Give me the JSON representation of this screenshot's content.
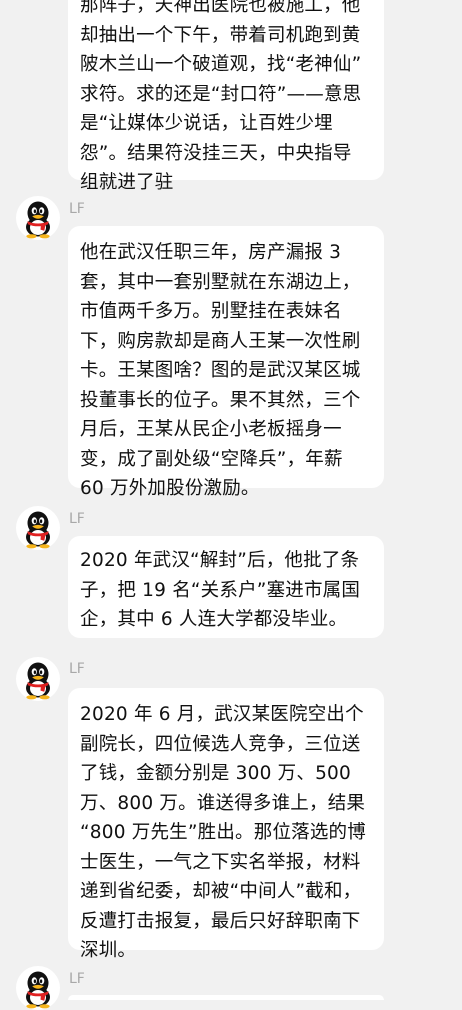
{
  "messages": [
    {
      "lines": [
        "那阵子，天神出医院也被施工，他",
        "却抽出一个下午，带着司机跑到黄",
        "陂木兰山一个破道观，找“老神仙”",
        "求符。求的还是“封口符”——意思",
        "是“让媒体少说话，让百姓少埋",
        "怨”。结果符没挂三天，中央指导",
        "组就进了驻"
      ]
    },
    {
      "sender": "LF",
      "avatar_icon": "qq-penguin-icon",
      "lines": [
        "他在武汉任职三年，房产漏报 3",
        "套，其中一套别墅就在东湖边上，",
        "市值两千多万。别墅挂在表妹名",
        "下，购房款却是商人王某一次性刷",
        "卡。王某图啥？图的是武汉某区城",
        "投董事长的位子。果不其然，三个",
        "月后，王某从民企小老板摇身一",
        "变，成了副处级“空降兵”，年薪",
        "60 万外加股份激励。"
      ]
    },
    {
      "sender": "LF",
      "avatar_icon": "qq-penguin-icon",
      "lines": [
        "2020 年武汉“解封”后，他批了条",
        "子，把 19 名“关系户”塞进市属国",
        "企，其中 6 人连大学都没毕业。"
      ]
    },
    {
      "sender": "LF",
      "avatar_icon": "qq-penguin-icon",
      "lines": [
        "2020 年 6 月，武汉某医院空出个",
        "副院长，四位候选人竞争，三位送",
        "了钱，金额分别是 300 万、500",
        "万、800 万。谁送得多谁上，结果",
        "“800 万先生”胜出。那位落选的博",
        "士医生，一气之下实名举报，材料",
        "递到省纪委，却被“中间人”截和，",
        "反遭打击报复，最后只好辞职南下",
        "深圳。"
      ]
    },
    {
      "sender": "LF",
      "avatar_icon": "qq-penguin-icon",
      "lines": []
    }
  ],
  "colors": {
    "background": "#f1f1f1",
    "bubble": "#ffffff",
    "text": "#111111",
    "sender": "#a8a8a8",
    "avatar_scarf": "#e02020"
  }
}
